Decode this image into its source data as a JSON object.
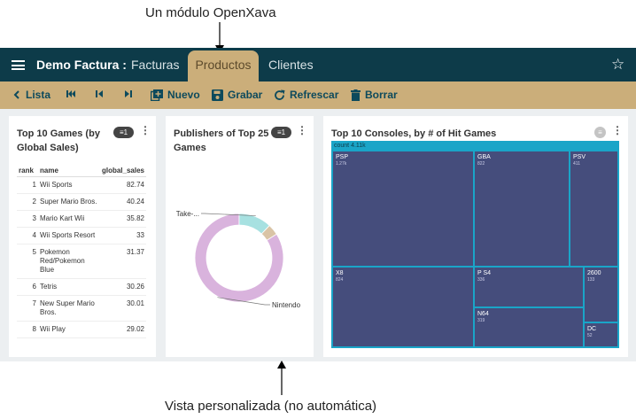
{
  "annotations": {
    "top": "Un módulo OpenXava",
    "bottom": "Vista personalizada (no automática)"
  },
  "topbar": {
    "app_title": "Demo Factura :",
    "tabs": [
      {
        "label": "Facturas"
      },
      {
        "label": "Productos",
        "active": true
      },
      {
        "label": "Clientes"
      }
    ]
  },
  "toolbar": {
    "lista": "Lista",
    "nuevo": "Nuevo",
    "grabar": "Grabar",
    "refrescar": "Refrescar",
    "borrar": "Borrar"
  },
  "card1": {
    "title_line1": "Top 10 Games (by",
    "title_line2": "Global Sales)",
    "filter_count": "1",
    "columns": [
      "rank",
      "name",
      "global_sales"
    ],
    "rows": [
      {
        "rank": "1",
        "name": "Wii Sports",
        "sales": "82.74"
      },
      {
        "rank": "2",
        "name": "Super Mario Bros.",
        "sales": "40.24"
      },
      {
        "rank": "3",
        "name": "Mario Kart Wii",
        "sales": "35.82"
      },
      {
        "rank": "4",
        "name": "Wii Sports Resort",
        "sales": "33"
      },
      {
        "rank": "5",
        "name": "Pokemon Red/Pokemon Blue",
        "sales": "31.37"
      },
      {
        "rank": "6",
        "name": "Tetris",
        "sales": "30.26"
      },
      {
        "rank": "7",
        "name": "New Super Mario Bros.",
        "sales": "30.01"
      },
      {
        "rank": "8",
        "name": "Wii Play",
        "sales": "29.02"
      }
    ]
  },
  "card2": {
    "title_line1": "Publishers of Top 25",
    "title_line2": "Games",
    "filter_count": "1"
  },
  "card3": {
    "title": "Top 10 Consoles, by # of Hit Games"
  },
  "chart_data": [
    {
      "type": "pie",
      "labels": [
        "Nintendo",
        "Take-...",
        ""
      ],
      "values": [
        21,
        3,
        1
      ],
      "colors": [
        "#d9b3dd",
        "#a7e1e1",
        "#d9c4a6"
      ]
    },
    {
      "type": "treemap",
      "root": {
        "label": "count",
        "value": "4.11k"
      },
      "nodes": [
        {
          "label": "PSP",
          "value": "1.27k"
        },
        {
          "label": "GBA",
          "value": "822"
        },
        {
          "label": "PSV",
          "value": "411"
        },
        {
          "label": "X8",
          "value": "824"
        },
        {
          "label": "P S4",
          "value": "336"
        },
        {
          "label": "2600",
          "value": "133"
        },
        {
          "label": "N64",
          "value": "319"
        },
        {
          "label": "DC",
          "value": "52"
        }
      ],
      "colors": {
        "fill": "#454d7c",
        "border": "#1aa5c8"
      }
    }
  ]
}
